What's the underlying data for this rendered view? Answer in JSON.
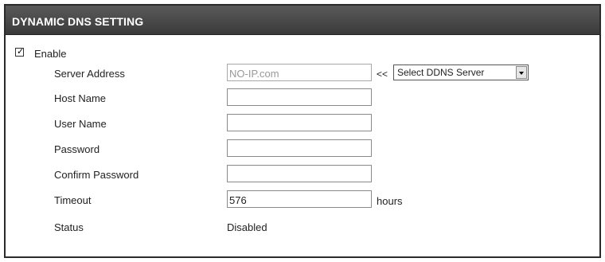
{
  "header": {
    "title": "DYNAMIC DNS SETTING"
  },
  "enable": {
    "label": "Enable",
    "checked": true
  },
  "server_address": {
    "label": "Server Address",
    "value": "NO-IP.com",
    "arrows": "<<",
    "select_value": "Select DDNS Server"
  },
  "host_name": {
    "label": "Host Name",
    "value": ""
  },
  "user_name": {
    "label": "User Name",
    "value": ""
  },
  "password": {
    "label": "Password",
    "value": ""
  },
  "confirm_password": {
    "label": "Confirm Password",
    "value": ""
  },
  "timeout": {
    "label": "Timeout",
    "value": "576",
    "unit": "hours"
  },
  "status": {
    "label": "Status",
    "value": "Disabled"
  }
}
